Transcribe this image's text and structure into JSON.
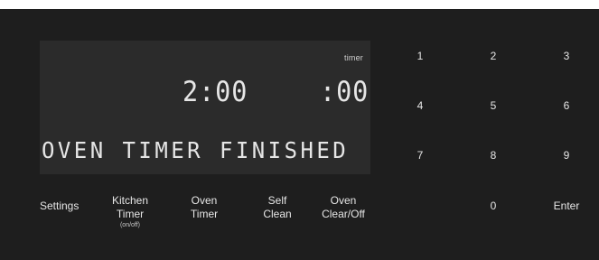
{
  "display": {
    "timer_label": "timer",
    "clock_time": "2:00",
    "timer_time": ":00",
    "message": "OVEN TIMER FINISHED"
  },
  "function_buttons": {
    "settings": "Settings",
    "kitchen_timer_line1": "Kitchen",
    "kitchen_timer_line2": "Timer",
    "kitchen_timer_sub": "(on/off)",
    "oven_timer_line1": "Oven",
    "oven_timer_line2": "Timer",
    "self_clean_line1": "Self",
    "self_clean_line2": "Clean",
    "oven_clear_line1": "Oven",
    "oven_clear_line2": "Clear/Off"
  },
  "keypad": {
    "k1": "1",
    "k2": "2",
    "k3": "3",
    "k4": "4",
    "k5": "5",
    "k6": "6",
    "k7": "7",
    "k8": "8",
    "k9": "9",
    "k0": "0",
    "enter": "Enter"
  }
}
